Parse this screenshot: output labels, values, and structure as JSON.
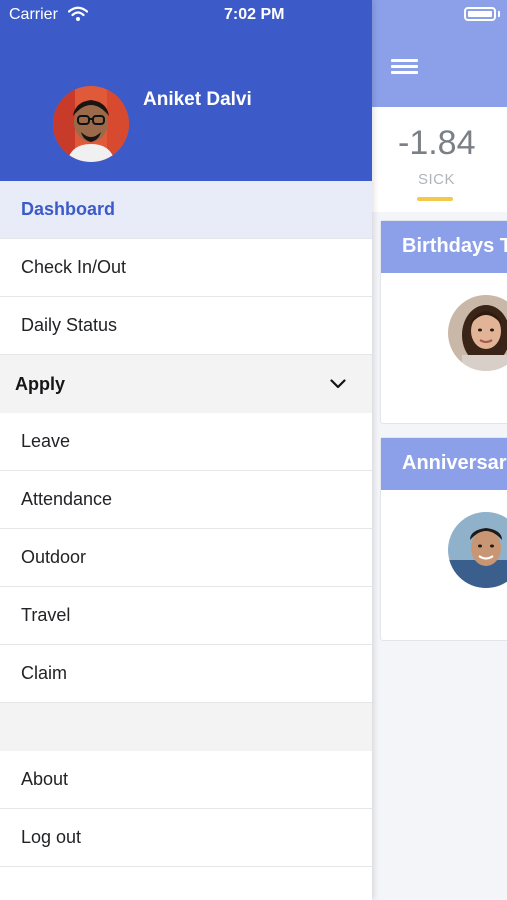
{
  "status_bar": {
    "carrier": "Carrier",
    "time": "7:02 PM"
  },
  "profile": {
    "name": "Aniket Dalvi"
  },
  "menu": {
    "items_top": [
      "Dashboard",
      "Check In/Out",
      "Daily Status"
    ],
    "apply_section": {
      "label": "Apply",
      "items": [
        "Leave",
        "Attendance",
        "Outdoor",
        "Travel",
        "Claim"
      ]
    },
    "items_bottom": [
      "About",
      "Log out"
    ]
  },
  "dashboard": {
    "leave_balance": {
      "value": "-1.84",
      "label": "SICK"
    },
    "birthdays_title": "Birthdays T",
    "anniversary_title": "Anniversar"
  },
  "colors": {
    "primary": "#3d5bc8",
    "light_header": "#8ca0ea",
    "accent_yellow": "#f2c94c"
  }
}
